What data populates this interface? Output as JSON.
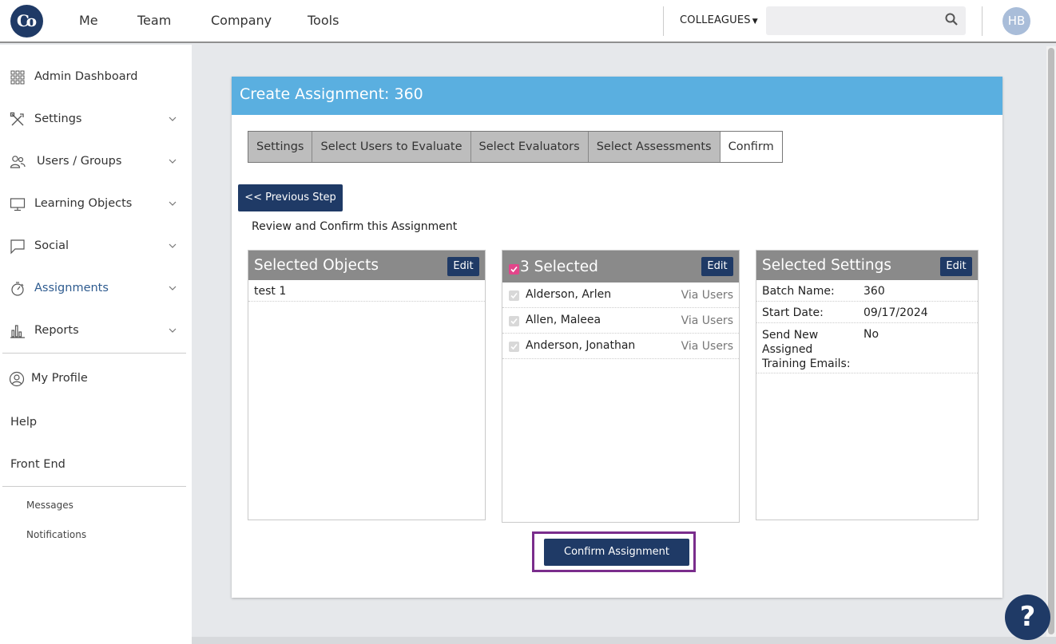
{
  "app": {
    "logo_text": "Co"
  },
  "topnav": {
    "items": [
      {
        "label": "Me"
      },
      {
        "label": "Team"
      },
      {
        "label": "Company"
      },
      {
        "label": "Tools"
      }
    ],
    "search_scope": "COLLEAGUES",
    "search_placeholder": "",
    "avatar_initials": "HB"
  },
  "sidebar": {
    "items": [
      {
        "label": "Admin Dashboard",
        "icon": "grid-icon",
        "expandable": false
      },
      {
        "label": "Settings",
        "icon": "tools-icon",
        "expandable": true
      },
      {
        "label": "Users / Groups",
        "icon": "users-icon",
        "expandable": true
      },
      {
        "label": "Learning Objects",
        "icon": "monitor-icon",
        "expandable": true
      },
      {
        "label": "Social",
        "icon": "chat-icon",
        "expandable": true
      },
      {
        "label": "Assignments",
        "icon": "stopwatch-icon",
        "expandable": true,
        "active": true
      },
      {
        "label": "Reports",
        "icon": "bar-chart-icon",
        "expandable": true
      }
    ],
    "profile_label": "My Profile",
    "help_label": "Help",
    "front_end_label": "Front End",
    "messages_label": "Messages",
    "notifications_label": "Notifications"
  },
  "panel": {
    "title": "Create Assignment: 360",
    "tabs": [
      {
        "label": "Settings"
      },
      {
        "label": "Select Users to Evaluate"
      },
      {
        "label": "Select Evaluators"
      },
      {
        "label": "Select Assessments"
      },
      {
        "label": "Confirm",
        "active": true
      }
    ],
    "prev_button": "<< Previous Step",
    "review_text": "Review and Confirm this Assignment",
    "objects_box": {
      "title": "Selected Objects",
      "edit_label": "Edit",
      "items": [
        "test 1"
      ]
    },
    "users_box": {
      "title": "3 Selected",
      "edit_label": "Edit",
      "users": [
        {
          "name": "Alderson, Arlen",
          "via": "Via Users"
        },
        {
          "name": "Allen, Maleea",
          "via": "Via Users"
        },
        {
          "name": "Anderson, Jonathan",
          "via": "Via Users"
        }
      ]
    },
    "settings_box": {
      "title": "Selected Settings",
      "edit_label": "Edit",
      "rows": [
        {
          "label": "Batch Name:",
          "value": "360"
        },
        {
          "label": "Start Date:",
          "value": "09/17/2024"
        },
        {
          "label": "Send New Assigned Training Emails:",
          "value": "No"
        }
      ]
    },
    "confirm_button": "Confirm Assignment"
  },
  "help_button": "?",
  "colors": {
    "navy": "#1f3a66",
    "header_blue": "#5aafe0",
    "highlight_purple": "#7a2d8c",
    "checkbox_pink": "#e2458a"
  }
}
